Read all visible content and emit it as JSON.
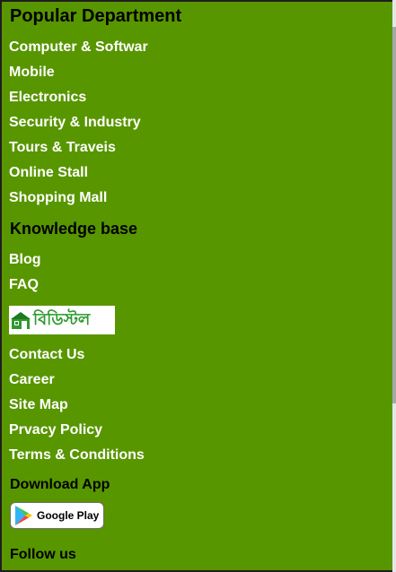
{
  "popular": {
    "title": "Popular Department",
    "items": [
      "Computer & Softwar",
      "Mobile",
      "Electronics",
      "Security & Industry",
      "Tours & Traveis",
      "Online Stall",
      "Shopping Mall"
    ]
  },
  "knowledge": {
    "title": "Knowledge base",
    "items": [
      "Blog",
      "FAQ"
    ]
  },
  "brand": {
    "logo_text": "বিডিস্টল",
    "logo_color": "#2e9a2e"
  },
  "info_links": [
    "Contact Us",
    "Career",
    "Site Map",
    "Prvacy Policy",
    "Terms & Conditions"
  ],
  "download": {
    "title": "Download App",
    "store_label": "Google Play",
    "store_icon": "google-play-icon"
  },
  "follow": {
    "title": "Follow us"
  },
  "colors": {
    "background": "#589600",
    "link": "#ffffff",
    "heading": "#000000"
  }
}
